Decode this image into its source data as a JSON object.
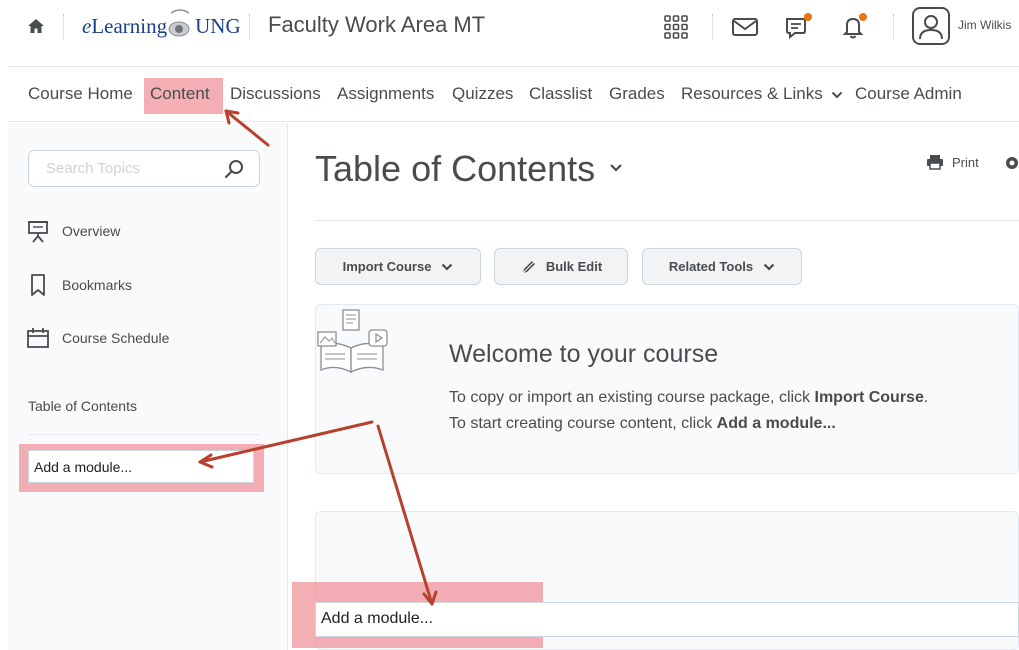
{
  "topbar": {
    "logo_prefix": "e",
    "logo_mid": "Learning",
    "logo_suffix": "UNG",
    "course_title": "Faculty Work Area MT",
    "user_name": "Jim Wilkis",
    "icons": [
      "home-icon",
      "waffle-icon",
      "mail-icon",
      "chat-icon",
      "bell-icon",
      "avatar-icon"
    ],
    "notification_color": "#e87511"
  },
  "nav": {
    "items": [
      "Course Home",
      "Content",
      "Discussions",
      "Assignments",
      "Quizzes",
      "Classlist",
      "Grades",
      "Resources & Links",
      "Course Admin"
    ]
  },
  "sidebar": {
    "search_placeholder": "Search Topics",
    "items": [
      {
        "label": "Overview",
        "icon": "presentation-icon"
      },
      {
        "label": "Bookmarks",
        "icon": "bookmark-icon"
      },
      {
        "label": "Course Schedule",
        "icon": "calendar-icon"
      }
    ],
    "toc_label": "Table of Contents",
    "add_module": "Add a module..."
  },
  "main": {
    "title": "Table of Contents",
    "print_label": "Print",
    "buttons": {
      "import": "Import Course",
      "bulk_edit": "Bulk Edit",
      "related_tools": "Related Tools"
    },
    "welcome": {
      "title": "Welcome to your course",
      "line1_prefix": "To copy or import an existing course package, click ",
      "line1_bold": "Import Course",
      "line1_suffix": ".",
      "line2_prefix": "To start creating course content, click ",
      "line2_bold": "Add a module..."
    },
    "add_module": "Add a module..."
  },
  "annotation": {
    "highlight_color": "#eb6e78",
    "arrow_color": "#b8402f"
  }
}
